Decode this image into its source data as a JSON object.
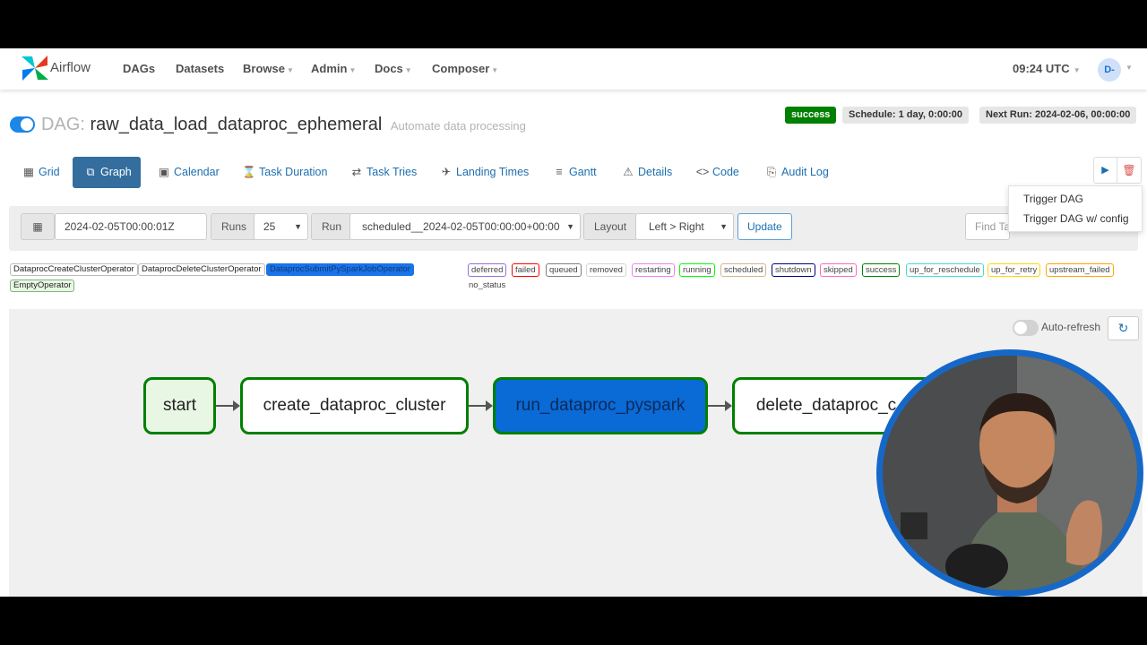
{
  "navbar": {
    "brand": "Airflow",
    "items": [
      "DAGs",
      "Datasets",
      "Browse",
      "Admin",
      "Docs",
      "Composer"
    ],
    "time": "09:24 UTC",
    "user_initials": "D-"
  },
  "dag": {
    "prefix": "DAG:",
    "id": "raw_data_load_dataproc_ephemeral",
    "description": "Automate data processing",
    "status": "success",
    "schedule": "Schedule: 1 day, 0:00:00",
    "next_run": "Next Run: 2024-02-06, 00:00:00"
  },
  "tabs": [
    "Grid",
    "Graph",
    "Calendar",
    "Task Duration",
    "Task Tries",
    "Landing Times",
    "Gantt",
    "Details",
    "Code",
    "Audit Log"
  ],
  "trigger_menu": {
    "trigger": "Trigger DAG",
    "trigger_config": "Trigger DAG w/ config"
  },
  "filters": {
    "date": "2024-02-05T00:00:01Z",
    "runs_label": "Runs",
    "runs_value": "25",
    "run_label": "Run",
    "run_value": "scheduled__2024-02-05T00:00:00+00:00",
    "layout_label": "Layout",
    "layout_value": "Left > Right",
    "update": "Update",
    "find_task_placeholder": "Find Ta"
  },
  "operators": [
    "DataprocCreateClusterOperator",
    "DataprocDeleteClusterOperator",
    "DataprocSubmitPySparkJobOperator",
    "EmptyOperator"
  ],
  "states": [
    {
      "label": "deferred",
      "color": "#9370db"
    },
    {
      "label": "failed",
      "color": "#ff0000"
    },
    {
      "label": "queued",
      "color": "#808080"
    },
    {
      "label": "removed",
      "color": "#d3d3d3"
    },
    {
      "label": "restarting",
      "color": "#ee82ee"
    },
    {
      "label": "running",
      "color": "#00ff00"
    },
    {
      "label": "scheduled",
      "color": "#d2b48c"
    },
    {
      "label": "shutdown",
      "color": "#000080"
    },
    {
      "label": "skipped",
      "color": "#ff69b4"
    },
    {
      "label": "success",
      "color": "#008000"
    },
    {
      "label": "up_for_reschedule",
      "color": "#40e0d0"
    },
    {
      "label": "up_for_retry",
      "color": "#ffd700"
    },
    {
      "label": "upstream_failed",
      "color": "#ffa500"
    }
  ],
  "no_status": "no_status",
  "graph": {
    "auto_refresh": "Auto-refresh",
    "nodes": [
      "start",
      "create_dataproc_cluster",
      "run_dataproc_pyspark",
      "delete_dataproc_c"
    ]
  }
}
